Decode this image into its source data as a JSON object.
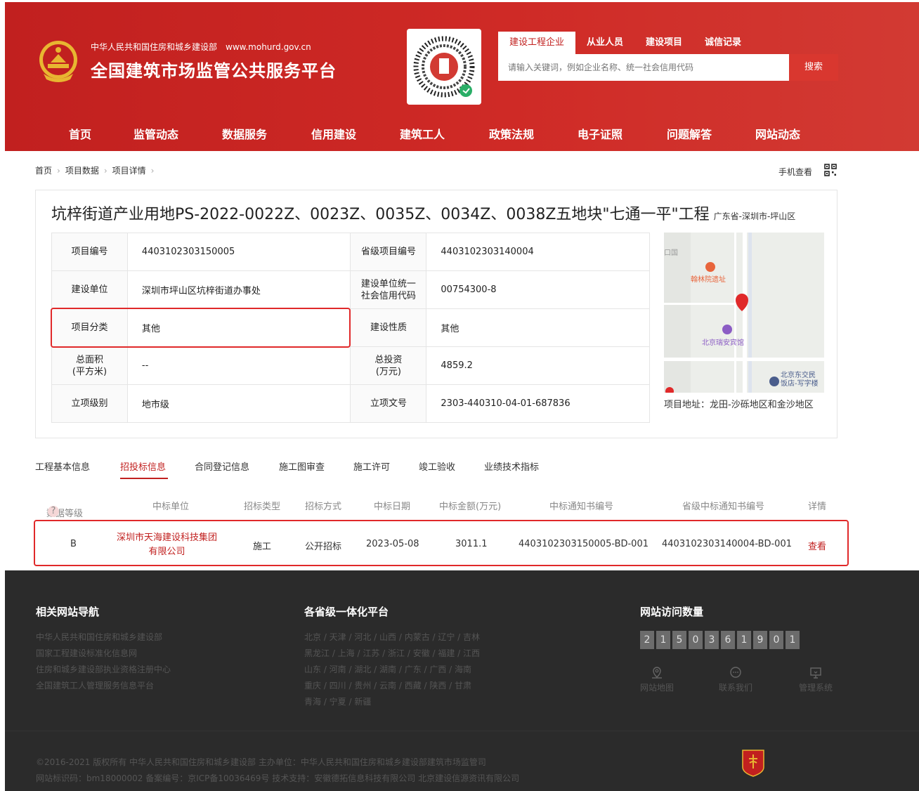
{
  "header": {
    "org_name": "中华人民共和国住房和城乡建设部",
    "site_url": "www.mohurd.gov.cn",
    "platform_title": "全国建筑市场监管公共服务平台",
    "search_tabs": [
      "建设工程企业",
      "从业人员",
      "建设项目",
      "诚信记录"
    ],
    "search_placeholder": "请输入关键词，例如企业名称、统一社会信用代码",
    "search_button": "搜索",
    "nav": [
      "首页",
      "监管动态",
      "数据服务",
      "信用建设",
      "建筑工人",
      "政策法规",
      "电子证照",
      "问题解答",
      "网站动态"
    ],
    "brand_color": "#c1201f"
  },
  "breadcrumb": [
    "首页",
    "项目数据",
    "项目详情"
  ],
  "mobile_view": "手机查看",
  "project": {
    "title": "坑梓街道产业用地PS-2022-0022Z、0023Z、0035Z、0034Z、0038Z五地块\"七通一平\"工程",
    "region": "广东省-深圳市-坪山区",
    "rows": [
      {
        "k1": "项目编号",
        "v1": "4403102303150005",
        "k2": "省级项目编号",
        "v2": "4403102303140004"
      },
      {
        "k1": "建设单位",
        "v1": "深圳市坪山区坑梓街道办事处",
        "k2": "建设单位统一社会信用代码",
        "v2": "00754300-8"
      },
      {
        "k1": "项目分类",
        "v1": "其他",
        "k2": "建设性质",
        "v2": "其他"
      },
      {
        "k1": "总面积(平方米)",
        "v1": "--",
        "k2": "总投资(万元)",
        "v2": "4859.2"
      },
      {
        "k1": "立项级别",
        "v1": "地市级",
        "k2": "立项文号",
        "v2": "2303-440310-04-01-687836"
      }
    ],
    "map_labels": [
      "口国",
      "翰林院遗址",
      "北京瑞安宾馆",
      "北京东交民",
      "饭店-写字楼"
    ],
    "address_label": "项目地址：龙田-沙砾地区和金沙地区"
  },
  "tabs": [
    "工程基本信息",
    "招投标信息",
    "合同登记信息",
    "施工图审查",
    "施工许可",
    "竣工验收",
    "业绩技术指标"
  ],
  "active_tab": "招投标信息",
  "bid_table": {
    "headers": [
      "数据等级",
      "中标单位",
      "招标类型",
      "招标方式",
      "中标日期",
      "中标金额(万元)",
      "中标通知书编号",
      "省级中标通知书编号",
      "详情"
    ],
    "help_mark": "?",
    "row": {
      "level": "B",
      "winner_line1": "深圳市天海建设科技集团",
      "winner_line2": "有限公司",
      "type": "施工",
      "method": "公开招标",
      "date": "2023-05-08",
      "amount": "3011.1",
      "notice_no": "4403102303150005-BD-001",
      "prov_notice_no": "4403102303140004-BD-001",
      "detail": "查看"
    }
  },
  "footer": {
    "nav_title": "相关网站导航",
    "nav_links": [
      "中华人民共和国住房和城乡建设部",
      "国家工程建设标准化信息网",
      "住房和城乡建设部执业资格注册中心",
      "全国建筑工人管理服务信息平台"
    ],
    "prov_title": "各省级一体化平台",
    "prov_lines": [
      "北京 / 天津 / 河北 / 山西 / 内蒙古 / 辽宁 / 吉林",
      "黑龙江 / 上海 / 江苏 / 浙江 / 安徽 / 福建 / 江西",
      "山东 / 河南 / 湖北 / 湖南 / 广东 / 广西 / 海南",
      "重庆 / 四川 / 贵州 / 云南 / 西藏 / 陕西 / 甘肃",
      "青海 / 宁夏 / 新疆"
    ],
    "visits_title": "网站访问数量",
    "visit_digits": [
      "2",
      "1",
      "5",
      "0",
      "3",
      "6",
      "1",
      "9",
      "0",
      "1"
    ],
    "tools": [
      "网站地图",
      "联系我们",
      "管理系统"
    ],
    "copyright_line1": "©2016-2021 版权所有 中华人民共和国住房和城乡建设部   主办单位：中华人民共和国住房和城乡建设部建筑市场监管司",
    "copyright_line2": "网站标识码：bm18000002   备案编号：京ICP备10036469号   技术支持：安徽德拓信息科技有限公司 北京建设信源资讯有限公司"
  }
}
